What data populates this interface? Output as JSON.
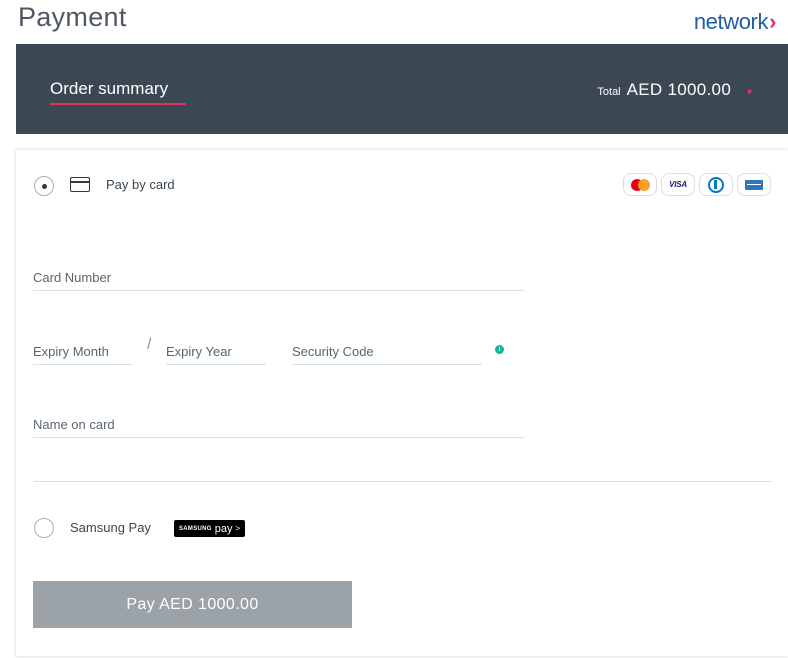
{
  "header": {
    "title": "Payment",
    "brand_name": "network",
    "brand_chevron": "›",
    "brand_color": "#1f5fa8",
    "brand_accent": "#e0315a"
  },
  "summary": {
    "label": "Order summary",
    "total_label": "Total",
    "total_value": "AED 1000.00",
    "expand_icon": "caret-down-icon",
    "background": "#3b4753"
  },
  "payment_methods": {
    "card": {
      "label": "Pay by card",
      "selected": true,
      "icon": "credit-card-icon",
      "accepted_brands": [
        "mastercard",
        "visa",
        "diners-club",
        "amex"
      ],
      "visa_text": "VISA"
    },
    "samsung": {
      "label": "Samsung Pay",
      "selected": false,
      "badge_small": "SAMSUNG",
      "badge_pay": "pay",
      "badge_arrow": ">"
    }
  },
  "form": {
    "card_number": {
      "label": "Card Number",
      "value": ""
    },
    "expiry_month": {
      "label": "Expiry Month",
      "value": ""
    },
    "separator": "/",
    "expiry_year": {
      "label": "Expiry Year",
      "value": ""
    },
    "security_code": {
      "label": "Security Code",
      "value": "",
      "info_icon": "info-icon",
      "info_glyph": "i",
      "info_color": "#1ab394"
    },
    "name_on_card": {
      "label": "Name on card",
      "value": ""
    }
  },
  "pay_button": {
    "label": "Pay AED 1000.00",
    "enabled": false,
    "color": "#9ba2a8"
  }
}
